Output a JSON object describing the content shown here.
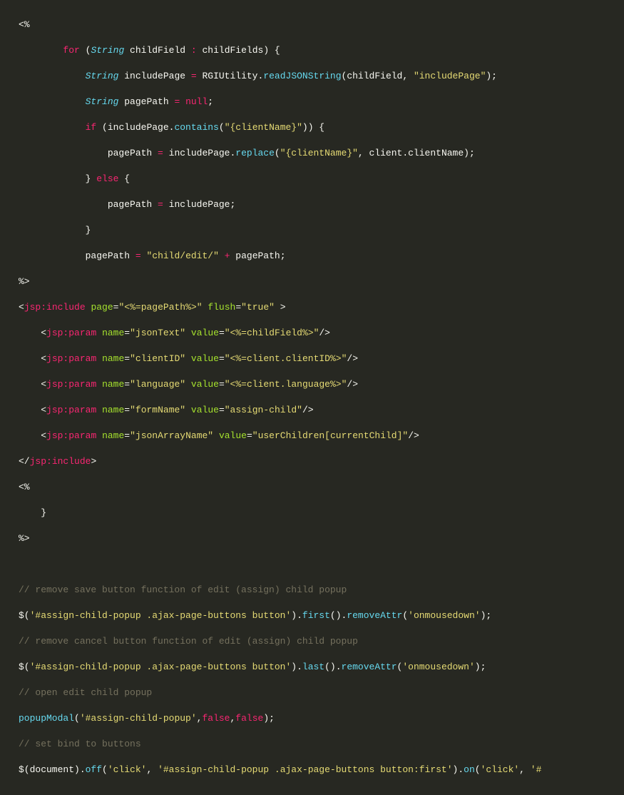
{
  "code": {
    "l1_open": "<%",
    "l2_for": "for",
    "l2_paren_open": " (",
    "l2_type1": "String",
    "l2_var1": " childField ",
    "l2_colon": ":",
    "l2_var2": " childFields",
    "l2_paren_close": ") {",
    "l3_type": "String",
    "l3_var": " includePage ",
    "l3_eq": "=",
    "l3_cls": " RGIUtility",
    "l3_dot": ".",
    "l3_fn": "readJSONString",
    "l3_args_open": "(childField, ",
    "l3_str": "\"includePage\"",
    "l3_args_close": ");",
    "l4_type": "String",
    "l4_var": " pagePath ",
    "l4_eq": "=",
    "l4_null": " null",
    "l4_semi": ";",
    "l5_if": "if",
    "l5_open": " (includePage.",
    "l5_fn": "contains",
    "l5_paren": "(",
    "l5_str": "\"{clientName}\"",
    "l5_close": ")) {",
    "l6_var": "pagePath ",
    "l6_eq": "=",
    "l6_expr": " includePage.",
    "l6_fn": "replace",
    "l6_paren": "(",
    "l6_str1": "\"{clientName}\"",
    "l6_comma": ", client.clientName);",
    "l7_close": "} ",
    "l7_else": "else",
    "l7_open": " {",
    "l8_var": "pagePath ",
    "l8_eq": "=",
    "l8_expr": " includePage;",
    "l9_close": "}",
    "l10_var": "pagePath ",
    "l10_eq": "=",
    "l10_sp": " ",
    "l10_str": "\"child/edit/\"",
    "l10_plus": " +",
    "l10_expr": " pagePath;",
    "l11_close": "%>",
    "l12_open": "<",
    "l12_tag": "jsp:include",
    "l12_sp": " ",
    "l12_attr1": "page",
    "l12_eq": "=",
    "l12_val1": "\"<%=pagePath%>\"",
    "l12_sp2": " ",
    "l12_attr2": "flush",
    "l12_val2": "\"true\"",
    "l12_close": " >",
    "l13_open": "<",
    "l13_tag": "jsp:param",
    "l13_sp": " ",
    "l13_attr1": "name",
    "l13_val1": "\"jsonText\"",
    "l13_sp2": " ",
    "l13_attr2": "value",
    "l13_val2": "\"<%=childField%>\"",
    "l13_close": "/>",
    "l14_val1": "\"clientID\"",
    "l14_val2": "\"<%=client.clientID%>\"",
    "l15_val1": "\"language\"",
    "l15_val2": "\"<%=client.language%>\"",
    "l16_val1": "\"formName\"",
    "l16_val2": "\"assign-child\"",
    "l17_val1": "\"jsonArrayName\"",
    "l17_val2": "\"userChildren[currentChild]\"",
    "l18_open": "</",
    "l18_tag": "jsp:include",
    "l18_close": ">",
    "l19": "<%",
    "l20": "    }",
    "l21": "%>",
    "c1": "// remove save button function of edit (assign) child popup",
    "j1a": "$(",
    "j1b": "'#assign-child-popup .ajax-page-buttons button'",
    "j1c": ").",
    "j1d": "first",
    "j1e": "().",
    "j1f": "removeAttr",
    "j1g": "(",
    "j1h": "'onmousedown'",
    "j1i": ");",
    "c2": "// remove cancel button function of edit (assign) child popup",
    "j2d": "last",
    "c3": "// open edit child popup",
    "j3a": "popupModal",
    "j3b": "(",
    "j3c": "'#assign-child-popup'",
    "j3d": ",",
    "j3e": "false",
    "j3f": ",",
    "j3g": "false",
    "j3h": ");",
    "c4": "// set bind to buttons",
    "j4a": "$(document).",
    "j4b": "off",
    "j4c": "(",
    "j4d": "'click'",
    "j4e": ", ",
    "j4f": "'#assign-child-popup .ajax-page-buttons button:first'",
    "j4g": ").",
    "j4h": "on",
    "j4i": "(",
    "j4j": "'click'",
    "j4k": ", ",
    "j4l": "'#"
  }
}
